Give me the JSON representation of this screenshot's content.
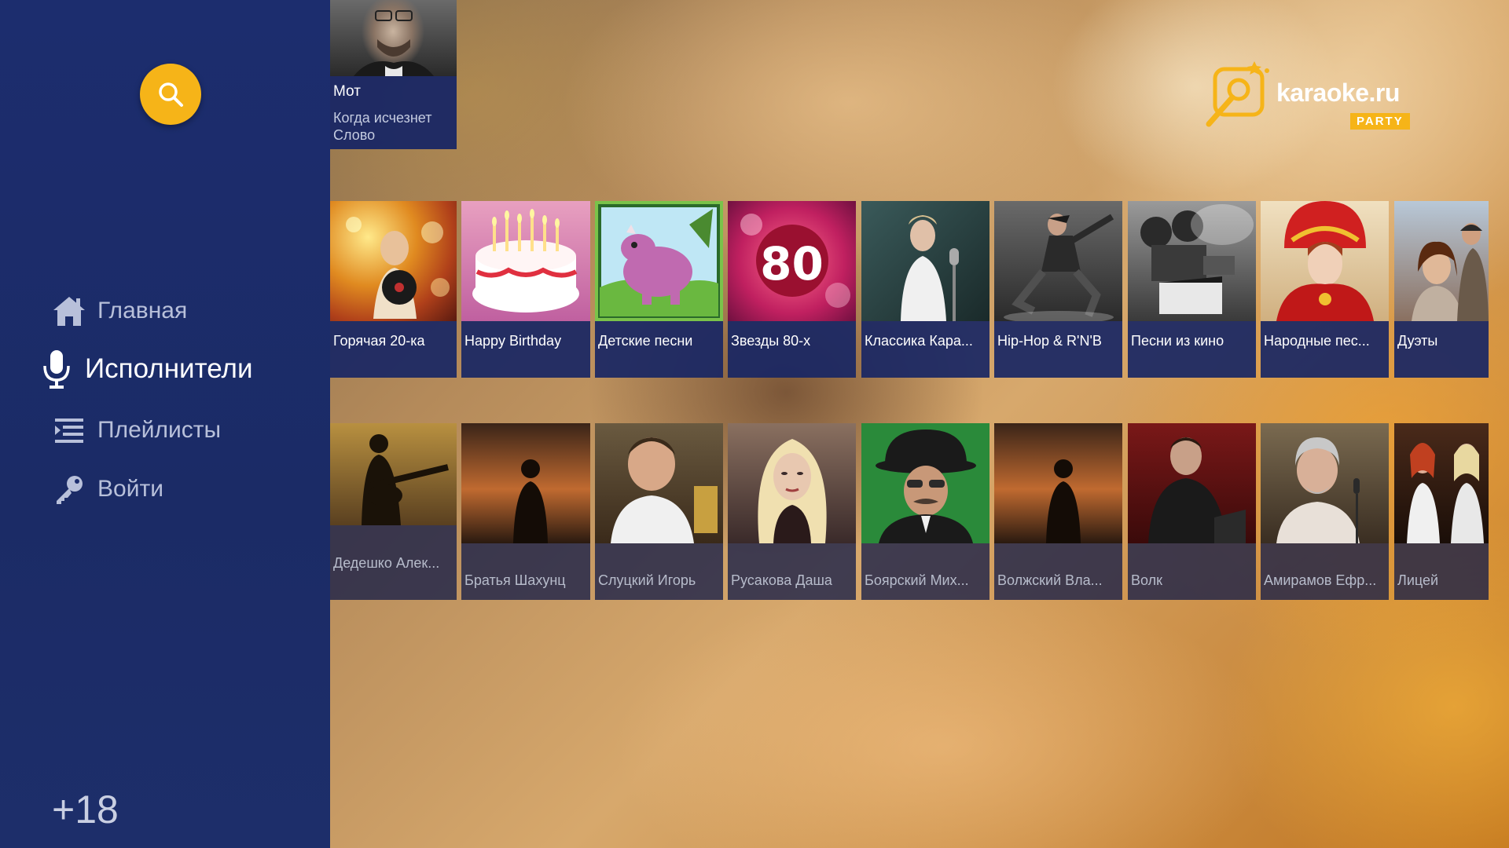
{
  "app": {
    "brand_name": "karaoke.ru",
    "brand_sub": "PARTY",
    "accent_color": "#f6b418",
    "sidebar_color": "#1c2d6e"
  },
  "sidebar": {
    "search_icon": "search-icon",
    "items": [
      {
        "label": "Главная",
        "icon": "home-icon",
        "active": false
      },
      {
        "label": "Исполнители",
        "icon": "microphone-icon",
        "active": true
      },
      {
        "label": "Плейлисты",
        "icon": "list-icon",
        "active": false
      },
      {
        "label": "Войти",
        "icon": "key-icon",
        "active": false
      }
    ],
    "age_rating": "+18"
  },
  "now_playing": {
    "artist": "Мот",
    "song": "Когда исчезнет Слово"
  },
  "playlists": [
    {
      "label": "Горячая 20-ка"
    },
    {
      "label": "Happy Birthday"
    },
    {
      "label": "Детские песни"
    },
    {
      "label": "Звезды 80-х",
      "thumb_text": "80"
    },
    {
      "label": "Классика Кара..."
    },
    {
      "label": "Hip-Hop & R'N'B"
    },
    {
      "label": "Песни из кино"
    },
    {
      "label": "Народные пес..."
    },
    {
      "label": "Дуэты"
    }
  ],
  "artists": [
    {
      "label": "Дедешко Алек..."
    },
    {
      "label": "Братья Шахунц"
    },
    {
      "label": "Слуцкий Игорь"
    },
    {
      "label": "Русакова Даша"
    },
    {
      "label": "Боярский Мих..."
    },
    {
      "label": "Волжский Вла..."
    },
    {
      "label": "Волк"
    },
    {
      "label": "Амирамов Ефр..."
    },
    {
      "label": "Лицей"
    }
  ]
}
